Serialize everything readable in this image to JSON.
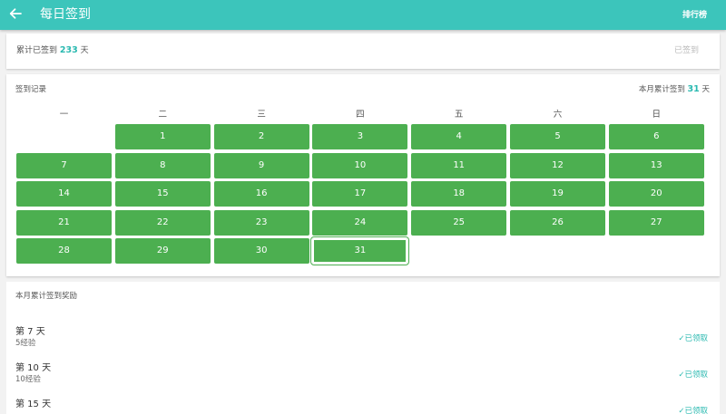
{
  "header": {
    "title": "每日签到",
    "rank_label": "排行榜",
    "back_icon": "arrow-left-icon"
  },
  "summary": {
    "label": "累计已签到",
    "count": "233",
    "unit": "天",
    "status": "已签到"
  },
  "calendar": {
    "title": "签到记录",
    "month_total_label": "本月累计签到",
    "month_total": "31",
    "month_total_unit": "天",
    "weekdays": [
      "一",
      "二",
      "三",
      "四",
      "五",
      "六",
      "日"
    ],
    "first_day_offset": 1,
    "days": [
      "1",
      "2",
      "3",
      "4",
      "5",
      "6",
      "7",
      "8",
      "9",
      "10",
      "11",
      "12",
      "13",
      "14",
      "15",
      "16",
      "17",
      "18",
      "19",
      "20",
      "21",
      "22",
      "23",
      "24",
      "25",
      "26",
      "27",
      "28",
      "29",
      "30",
      "31"
    ],
    "today": "31",
    "signed_color": "#4caf50"
  },
  "rewards": {
    "title": "本月累计签到奖励",
    "items": [
      {
        "day": "第 7 天",
        "exp": "5经验",
        "status": "✓已领取"
      },
      {
        "day": "第 10 天",
        "exp": "10经验",
        "status": "✓已领取"
      },
      {
        "day": "第 15 天",
        "exp": "",
        "status": "✓已领取"
      }
    ]
  },
  "colors": {
    "primary": "#3cc5bb",
    "accent": "#2ab9b0"
  }
}
